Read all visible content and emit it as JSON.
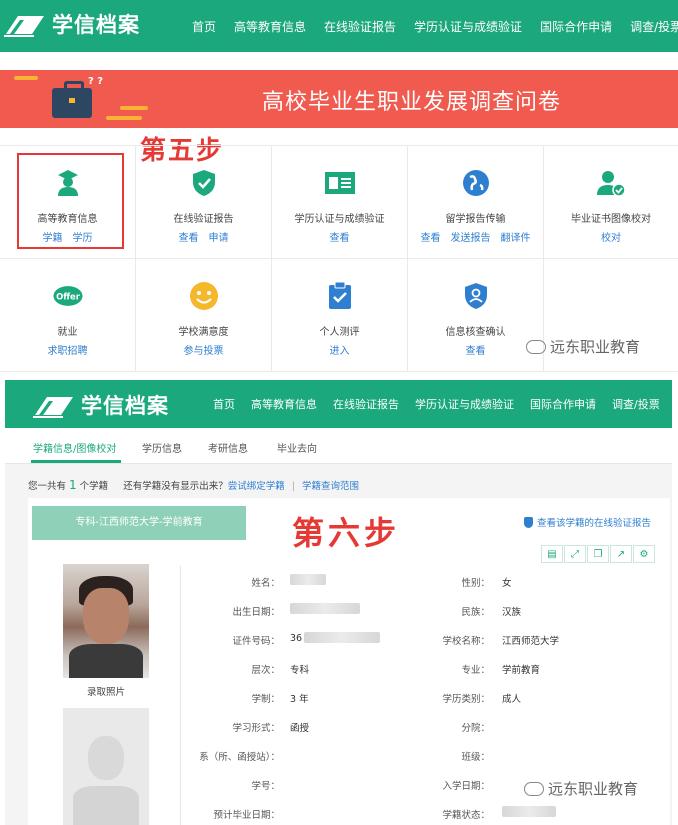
{
  "site": {
    "name": "学信档案"
  },
  "nav1": {
    "items": [
      "首页",
      "高等教育信息",
      "在线验证报告",
      "学历认证与成绩验证",
      "国际合作申请",
      "调查/投票"
    ]
  },
  "banner": {
    "title": "高校毕业生职业发展调查问卷",
    "icon": "briefcase-icon"
  },
  "steps": {
    "five": "第五步",
    "six": "第六步"
  },
  "services": [
    {
      "name": "高等教育信息",
      "links": [
        "学籍",
        "学历"
      ],
      "icon": "graduate-icon",
      "color": "#1ca87d"
    },
    {
      "name": "在线验证报告",
      "links": [
        "查看",
        "申请"
      ],
      "icon": "shield-check-icon",
      "color": "#1ca87d"
    },
    {
      "name": "学历认证与成绩验证",
      "links": [
        "查看"
      ],
      "icon": "id-card-icon",
      "color": "#1ca87d"
    },
    {
      "name": "留学报告传输",
      "links": [
        "查看",
        "发送报告",
        "翻译件"
      ],
      "icon": "globe-icon",
      "color": "#2f7fd0"
    },
    {
      "name": "毕业证书图像校对",
      "links": [
        "校对"
      ],
      "icon": "user-check-icon",
      "color": "#1ca87d"
    },
    {
      "name": "就业",
      "links": [
        "求职招聘"
      ],
      "icon": "offer-icon",
      "icon_text": "Offer",
      "color": "#1ca87d"
    },
    {
      "name": "学校满意度",
      "links": [
        "参与投票"
      ],
      "icon": "smile-icon",
      "color": "#f5b72c"
    },
    {
      "name": "个人测评",
      "links": [
        "进入"
      ],
      "icon": "clipboard-check-icon",
      "color": "#2f7fd0"
    },
    {
      "name": "信息核查确认",
      "links": [
        "查看"
      ],
      "icon": "shield-user-icon",
      "color": "#2f7fd0"
    }
  ],
  "watermark": "远东职业教育",
  "nav2": {
    "items": [
      "首页",
      "高等教育信息",
      "在线验证报告",
      "学历认证与成绩验证",
      "国际合作申请",
      "调查/投票"
    ]
  },
  "subnav": [
    "学籍信息/图像校对",
    "学历信息",
    "考研信息",
    "毕业去向"
  ],
  "summary": {
    "prefix": "您一共有",
    "count": "1",
    "suffix": "个学籍",
    "question": "还有学籍没有显示出来？",
    "bind_link": "尝试绑定学籍",
    "sep": "|",
    "range_link": "学籍查询范围"
  },
  "record": {
    "tag": "专科-江西师范大学-学前教育",
    "verify_link": "查看该学籍的在线验证报告",
    "toolbar_icons": [
      "print-icon",
      "expand-icon",
      "copy-icon",
      "share-icon",
      "settings-icon"
    ],
    "photo_caption": "录取照片",
    "left_fields": [
      {
        "label": "姓名：",
        "value": ""
      },
      {
        "label": "出生日期：",
        "value": ""
      },
      {
        "label": "证件号码：",
        "value": "36"
      },
      {
        "label": "层次：",
        "value": "专科"
      },
      {
        "label": "学制：",
        "value": "3 年"
      },
      {
        "label": "学习形式：",
        "value": "函授"
      },
      {
        "label": "系（所、函授站）：",
        "value": ""
      },
      {
        "label": "学号：",
        "value": ""
      },
      {
        "label": "预计毕业日期：",
        "value": ""
      }
    ],
    "right_fields": [
      {
        "label": "性别：",
        "value": "女"
      },
      {
        "label": "民族：",
        "value": "汉族"
      },
      {
        "label": "学校名称：",
        "value": "江西师范大学"
      },
      {
        "label": "专业：",
        "value": "学前教育"
      },
      {
        "label": "学历类别：",
        "value": "成人"
      },
      {
        "label": "分院：",
        "value": ""
      },
      {
        "label": "班级：",
        "value": ""
      },
      {
        "label": "入学日期：",
        "value": ""
      },
      {
        "label": "学籍状态：",
        "value": ""
      }
    ]
  }
}
